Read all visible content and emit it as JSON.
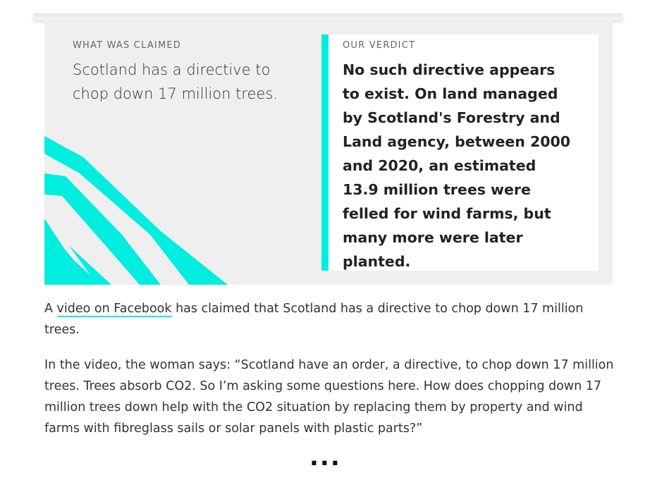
{
  "claim": {
    "label": "WHAT WAS CLAIMED",
    "text": "Scotland has a directive to chop down 17 million trees."
  },
  "verdict": {
    "label": "OUR VERDICT",
    "text": "No such directive appears to exist. On land managed by Scotland's Forestry and Land agency, between 2000 and 2020, an estimated 13.9 million trees were felled for wind farms, but many more were later planted."
  },
  "article": {
    "p1_prefix": "A ",
    "p1_link": "video on Facebook",
    "p1_suffix": " has claimed that Scotland has a directive to chop down 17 million trees.",
    "p2": "In the video, the woman says: “Scotland have an order, a directive, to chop down 17 million trees. Trees absorb CO2. So I’m asking some questions here. How does chopping down 17 million trees down help with the CO2 situation by replacing them by property and wind farms with fibreglass sails or solar panels with plastic parts?”"
  },
  "more": "...",
  "colors": {
    "accent": "#00eee0",
    "panel": "#efefef"
  }
}
